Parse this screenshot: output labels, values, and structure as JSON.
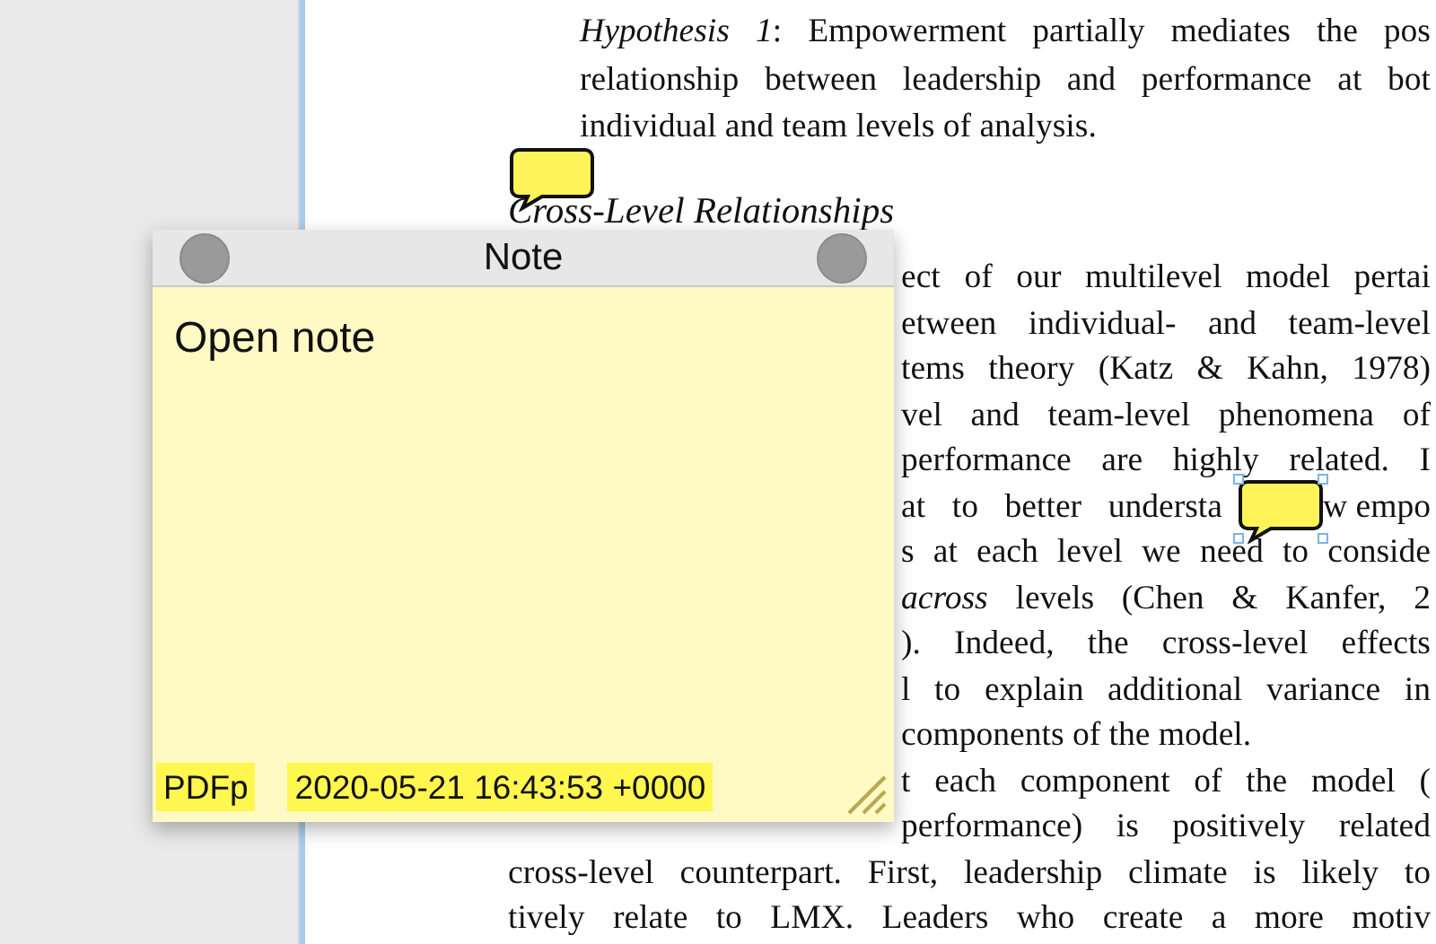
{
  "document": {
    "paragraphs": [
      {
        "kind": "hypothesis",
        "lines": [
          {
            "kind": "full",
            "text": "*Hypothesis 1*: Empowerment partially mediates the pos"
          },
          {
            "kind": "full",
            "text": "relationship between leadership and performance at bot"
          },
          {
            "kind": "last",
            "text": "individual and team levels of analysis."
          }
        ]
      },
      {
        "kind": "heading",
        "lines": [
          {
            "kind": "last",
            "text": "Cross-Level Relationships"
          }
        ]
      },
      {
        "kind": "body",
        "lines": [
          {
            "kind": "tail",
            "text": "ect of our multilevel model pertai"
          },
          {
            "kind": "tail",
            "text": "etween individual- and team-level"
          },
          {
            "kind": "tail",
            "text": "tems theory (Katz & Kahn, 1978)"
          },
          {
            "kind": "tail",
            "text": "vel and team-level phenomena of"
          },
          {
            "kind": "tail",
            "text": "performance are highly related. I"
          },
          {
            "kind": "split",
            "parts": [
              "at to better understa",
              "w empo"
            ]
          },
          {
            "kind": "tail",
            "text": "s at each level we need to conside"
          },
          {
            "kind": "tail",
            "text": "*across* levels (Chen & Kanfer, 2"
          },
          {
            "kind": "tail",
            "text": "). Indeed, the cross-level effects"
          },
          {
            "kind": "tail",
            "text": "l to explain additional variance in"
          },
          {
            "kind": "tail_end",
            "text": "components of the model."
          }
        ]
      },
      {
        "kind": "body",
        "lines": [
          {
            "kind": "tail",
            "text": "t each component of the model ("
          },
          {
            "kind": "tail",
            "text": "performance) is positively related"
          },
          {
            "kind": "full",
            "text": "cross-level counterpart. First, leadership climate is likely to"
          },
          {
            "kind": "full",
            "text": "tively relate to LMX. Leaders who create a more motiv"
          }
        ]
      }
    ]
  },
  "annotations": [
    {
      "selected": false
    },
    {
      "selected": true
    }
  ],
  "note": {
    "title": "Note",
    "text": "Open note",
    "author": "PDFp",
    "date": "2020-05-21 16:43:53 +0000"
  }
}
